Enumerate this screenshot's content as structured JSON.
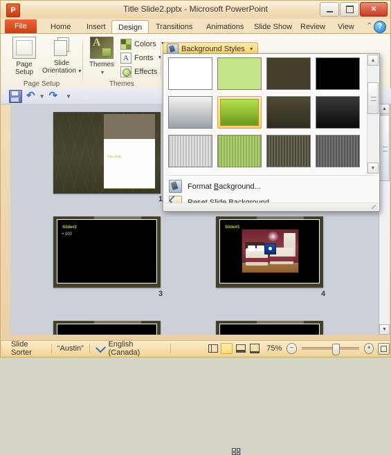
{
  "window": {
    "title": "Title Slide2.pptx  -  Microsoft PowerPoint",
    "logo": "P",
    "minimize": "minimize-icon",
    "maximize": "maximize-icon",
    "close": "✕"
  },
  "tabs": [
    {
      "label": "File",
      "active": false,
      "file": true
    },
    {
      "label": "Home",
      "active": false
    },
    {
      "label": "Insert",
      "active": false
    },
    {
      "label": "Design",
      "active": true
    },
    {
      "label": "Transitions",
      "active": false
    },
    {
      "label": "Animations",
      "active": false
    },
    {
      "label": "Slide Show",
      "active": false
    },
    {
      "label": "Review",
      "active": false
    },
    {
      "label": "View",
      "active": false
    }
  ],
  "ribbon": {
    "collapse": "⌃",
    "help": "?",
    "groups": [
      {
        "label": "Page Setup"
      },
      {
        "label": "Themes"
      }
    ],
    "page_setup": {
      "page_setup_line1": "Page",
      "page_setup_line2": "Setup",
      "slide_orientation_line1": "Slide",
      "slide_orientation_line2": "Orientation",
      "caret": "▼"
    },
    "themes": {
      "themes_label": "Themes",
      "themes_caret": "▼",
      "colors": "Colors",
      "fonts": "Fonts",
      "effects": "Effects",
      "fonts_glyph": "A",
      "caret": "▼"
    },
    "background_styles": {
      "label": "Background Styles",
      "caret": "▼"
    }
  },
  "qat": {
    "save": "save-icon",
    "undo": "↶",
    "undo_caret": "▼",
    "redo": "↷",
    "customize_caret": "▼"
  },
  "background_dropdown": {
    "rows": [
      {
        "style": "solid",
        "items": [
          {
            "name": "style-1",
            "color": "#ffffff",
            "selected": false
          },
          {
            "name": "style-2",
            "color": "#c5e487",
            "selected": false
          },
          {
            "name": "style-3",
            "color": "#45402c",
            "selected": false
          },
          {
            "name": "style-4",
            "color": "#000000",
            "selected": false
          }
        ]
      },
      {
        "style": "gradient",
        "items": [
          {
            "name": "style-5",
            "color": "#f2f2f2",
            "color2": "#9aa0a6",
            "selected": false
          },
          {
            "name": "style-6",
            "color": "#b6e051",
            "color2": "#6a9a18",
            "selected": true
          },
          {
            "name": "style-7",
            "color": "#504a34",
            "color2": "#302c1e",
            "selected": false
          },
          {
            "name": "style-8",
            "color": "#3a3a3a",
            "color2": "#0a0a0a",
            "selected": false
          }
        ]
      },
      {
        "style": "pattern",
        "items": [
          {
            "name": "style-9",
            "color": "#dcdcdc",
            "selected": false
          },
          {
            "name": "style-10",
            "color": "#a7cb61",
            "selected": false
          },
          {
            "name": "style-11",
            "color": "#55513f",
            "selected": false
          },
          {
            "name": "style-12",
            "color": "#5f5f5f",
            "selected": false
          }
        ]
      }
    ],
    "scroll_up": "▲",
    "scroll_down": "▼",
    "menu_items": [
      {
        "name": "format-background",
        "pre": "F",
        "under": "B",
        "label_a": "Format ",
        "label_b": "ackground..."
      },
      {
        "name": "reset-slide-background",
        "pre": "",
        "under": "R",
        "label_a": "",
        "label_b": "eset Slide Background"
      }
    ]
  },
  "slides": [
    {
      "number": "1",
      "type": "title",
      "title": "Title Slide"
    },
    {
      "number": "3",
      "type": "bullets",
      "title": "Slide#2",
      "bullet": "• 100"
    },
    {
      "number": "4",
      "type": "photo",
      "title": "Slide#3"
    }
  ],
  "scrollbars": {
    "main_up": "▲",
    "main_down": "▼"
  },
  "statusbar": {
    "view_name": "Slide Sorter",
    "theme_name": "“Austin”",
    "spellcheck": "spellcheck-icon",
    "language": "English (Canada)",
    "views": [
      {
        "name": "normal-view-button",
        "active": false
      },
      {
        "name": "slide-sorter-view-button",
        "active": true
      },
      {
        "name": "reading-view-button",
        "active": false
      },
      {
        "name": "slide-show-button",
        "active": false
      }
    ],
    "zoom_level": "75%",
    "zoom_out": "−",
    "zoom_in": "+",
    "fit_window": "fit-slide-icon"
  }
}
